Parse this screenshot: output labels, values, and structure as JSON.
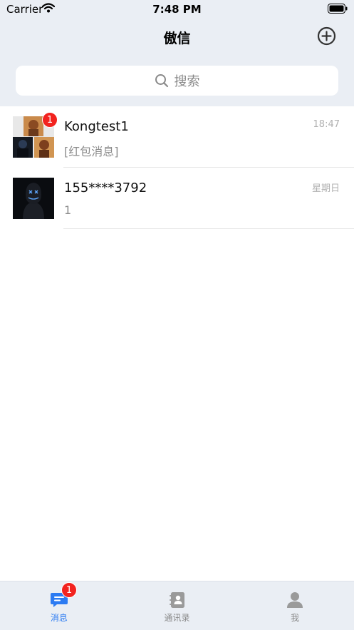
{
  "status_bar": {
    "carrier": "Carrier",
    "time": "7:48 PM"
  },
  "header": {
    "title": "傲信"
  },
  "search": {
    "placeholder": "搜索"
  },
  "conversations": [
    {
      "name": "Kongtest1",
      "preview": "[红包消息]",
      "time": "18:47",
      "badge": "1"
    },
    {
      "name": "155****3792",
      "preview": "1",
      "time": "星期日"
    }
  ],
  "tabs": [
    {
      "label": "消息",
      "icon": "chat-icon",
      "badge": "1",
      "active": true
    },
    {
      "label": "通讯录",
      "icon": "contacts-icon"
    },
    {
      "label": "我",
      "icon": "person-icon"
    }
  ],
  "colors": {
    "accent": "#2c7bf2",
    "badge": "#f2231f",
    "header_bg": "#eaeef4"
  }
}
